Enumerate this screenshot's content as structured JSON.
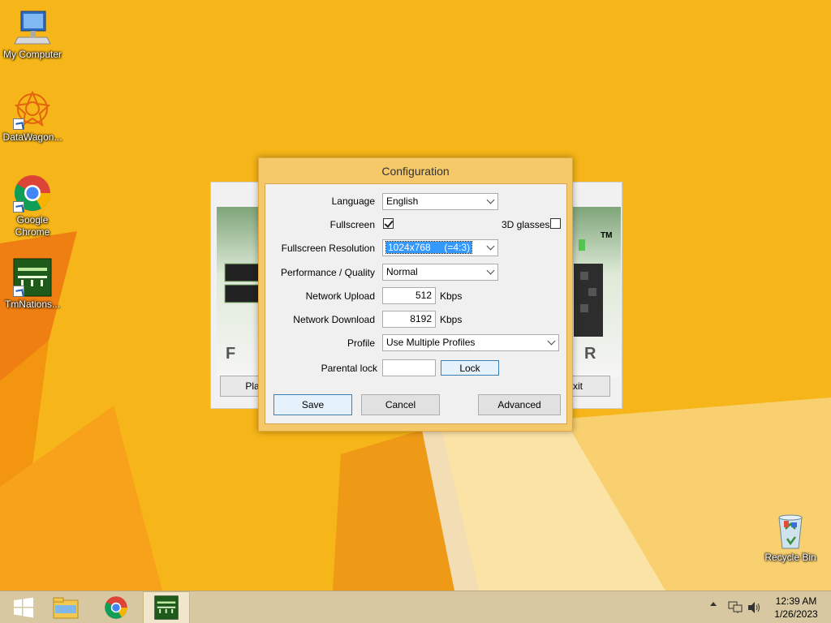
{
  "desktop": {
    "icons": [
      {
        "label": "My Computer",
        "icon": "computer-icon"
      },
      {
        "label": "DataWagon...",
        "icon": "datawagon-icon"
      },
      {
        "label": "Google Chrome",
        "icon": "chrome-icon"
      },
      {
        "label": "TmNations...",
        "icon": "tmnations-icon"
      },
      {
        "label": "Recycle Bin",
        "icon": "recycle-bin-icon"
      }
    ]
  },
  "game_window": {
    "play_label": "Pla",
    "exit_label": "xit",
    "logo_tm": "TM",
    "letter_left": "F",
    "letter_right": "R"
  },
  "dialog": {
    "title": "Configuration",
    "language": {
      "label": "Language",
      "value": "English"
    },
    "fullscreen": {
      "label": "Fullscreen",
      "checked": true
    },
    "glasses": {
      "label": "3D glasses",
      "checked": false
    },
    "resolution": {
      "label": "Fullscreen Resolution",
      "value": "1024x768     (=4:3)"
    },
    "quality": {
      "label": "Performance / Quality",
      "value": "Normal"
    },
    "upload": {
      "label": "Network Upload",
      "value": "512",
      "unit": "Kbps"
    },
    "download": {
      "label": "Network Download",
      "value": "8192",
      "unit": "Kbps"
    },
    "profile": {
      "label": "Profile",
      "value": "Use Multiple Profiles"
    },
    "parental": {
      "label": "Parental lock",
      "value": "",
      "button": "Lock"
    },
    "buttons": {
      "save": "Save",
      "cancel": "Cancel",
      "advanced": "Advanced"
    }
  },
  "taskbar": {
    "clock_time": "12:39 AM",
    "clock_date": "1/26/2023"
  },
  "colors": {
    "wallpaper": "#f6b518",
    "dialog_frame": "#f5c86a",
    "taskbar": "#d7c8a2"
  }
}
